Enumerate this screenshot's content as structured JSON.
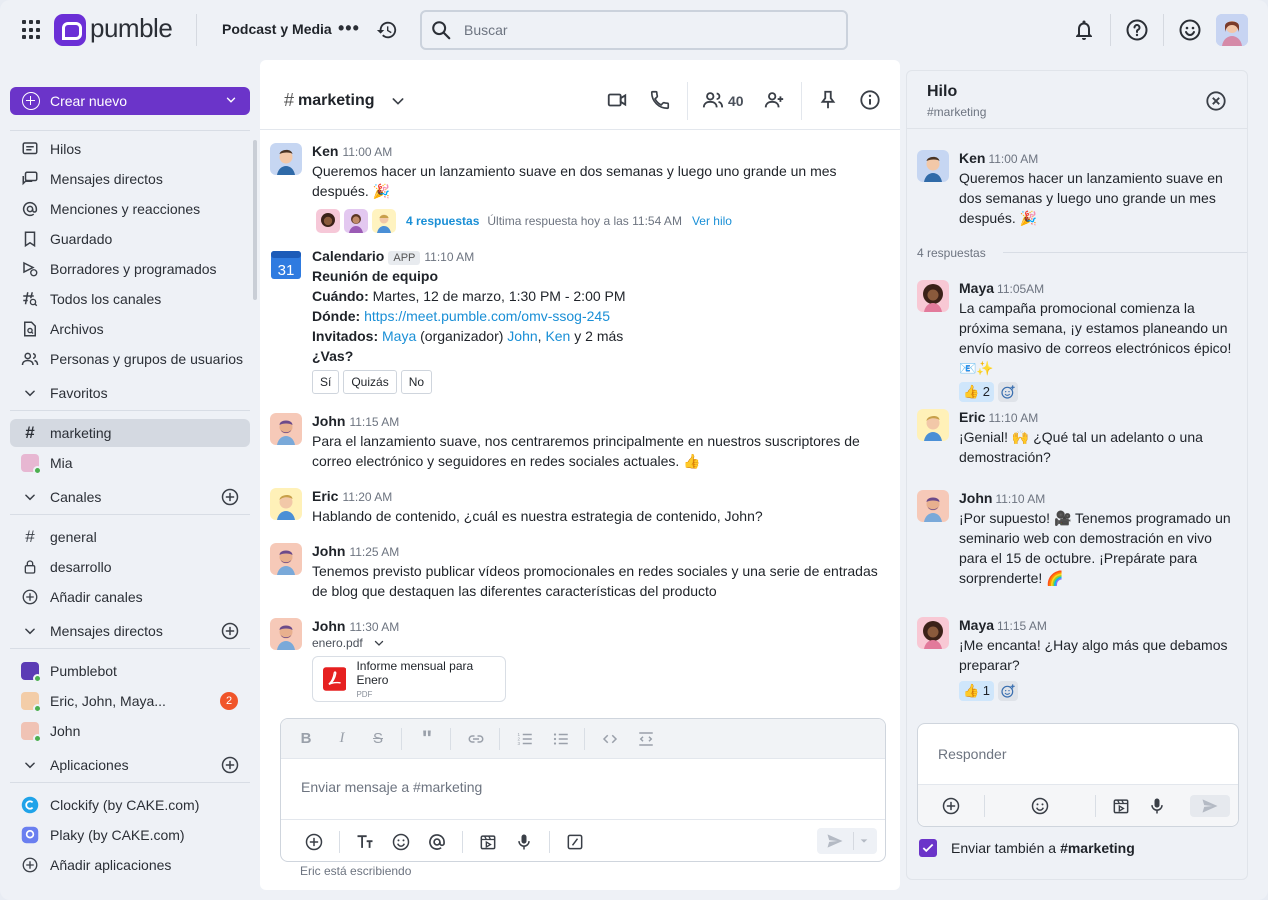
{
  "topbar": {
    "logo_text": "pumble",
    "workspace": "Podcast y Media",
    "search_placeholder": "Buscar"
  },
  "sidebar": {
    "create_label": "Crear nuevo",
    "nav": [
      {
        "label": "Hilos",
        "icon": "threads-icon"
      },
      {
        "label": "Mensajes directos",
        "icon": "direct-messages-icon"
      },
      {
        "label": "Menciones y reacciones",
        "icon": "at-icon"
      },
      {
        "label": "Guardado",
        "icon": "bookmark-icon"
      },
      {
        "label": "Borradores y programados",
        "icon": "drafts-icon"
      },
      {
        "label": "Todos los canales",
        "icon": "channels-search-icon"
      },
      {
        "label": "Archivos",
        "icon": "files-icon"
      },
      {
        "label": "Personas y grupos de usuarios",
        "icon": "people-icon"
      }
    ],
    "favorites_label": "Favoritos",
    "favorites": [
      {
        "label": "marketing"
      },
      {
        "label": "Mia"
      }
    ],
    "channels_label": "Canales",
    "channels": [
      {
        "label": "general"
      },
      {
        "label": "desarrollo"
      },
      {
        "label": "Añadir canales"
      }
    ],
    "dms_label": "Mensajes directos",
    "dms": [
      {
        "label": "Pumblebot"
      },
      {
        "label": "Eric, John, Maya...",
        "badge": "2"
      },
      {
        "label": "John"
      }
    ],
    "apps_label": "Aplicaciones",
    "apps": [
      {
        "label": "Clockify (by CAKE.com)"
      },
      {
        "label": "Plaky (by CAKE.com)"
      },
      {
        "label": "Añadir aplicaciones"
      }
    ]
  },
  "channel": {
    "name": "marketing",
    "member_count": "40"
  },
  "messages": [
    {
      "author": "Ken",
      "time": "11:00 AM",
      "text": "Queremos hacer un lanzamiento suave en dos semanas y luego uno grande un mes después. 🎉",
      "replies_label": "4 respuestas",
      "last_reply": "Última respuesta hoy a las 11:54 AM",
      "view_thread": "Ver hilo"
    },
    {
      "author": "Calendario",
      "tag": "APP",
      "time": "11:10 AM",
      "event_title": "Reunión de equipo",
      "when_label": "Cuándo:",
      "when_value": "Martes, 12 de marzo, 1:30 PM - 2:00 PM",
      "where_label": "Dónde:",
      "where_value": "https://meet.pumble.com/omv-ssog-245",
      "guests_label": "Invitados:",
      "guest_1": "Maya",
      "guest_1_note": "(organizador)",
      "guest_2": "John",
      "guest_3": "Ken",
      "guests_more": "y 2 más",
      "question": "¿Vas?",
      "rsvp": [
        "Sí",
        "Quizás",
        "No"
      ]
    },
    {
      "author": "John",
      "time": "11:15 AM",
      "text": "Para el lanzamiento suave, nos centraremos principalmente en nuestros suscriptores de correo electrónico y seguidores en redes sociales actuales. 👍"
    },
    {
      "author": "Eric",
      "time": "11:20 AM",
      "text": "Hablando de contenido, ¿cuál es nuestra estrategia de contenido, John?"
    },
    {
      "author": "John",
      "time": "11:25 AM",
      "text": "Tenemos previsto publicar vídeos promocionales en redes sociales y una serie de entradas de blog que destaquen las diferentes características del producto"
    },
    {
      "author": "John",
      "time": "11:30 AM",
      "file_name": "enero.pdf",
      "file_title": "Informe mensual para Enero",
      "file_type": "PDF"
    }
  ],
  "composer": {
    "placeholder": "Enviar mensaje a #marketing",
    "typing": "Eric está escribiendo"
  },
  "thread": {
    "title": "Hilo",
    "subtitle": "#marketing",
    "parent": {
      "author": "Ken",
      "time": "11:00 AM",
      "text": "Queremos hacer un lanzamiento suave en dos semanas y luego uno grande un mes después. 🎉"
    },
    "reply_count": "4 respuestas",
    "replies": [
      {
        "author": "Maya",
        "time": "11:05AM",
        "text": "La campaña promocional comienza la próxima semana, ¡y estamos planeando un envío masivo de correos electrónicos épico! 📧✨",
        "reaction": "👍 2"
      },
      {
        "author": "Eric",
        "time": "11:10 AM",
        "text": "¡Genial! 🙌 ¿Qué tal un adelanto o una demostración?"
      },
      {
        "author": "John",
        "time": "11:10 AM",
        "text": "¡Por supuesto! 🎥 Tenemos programado un seminario web con demostración en vivo para el 15 de octubre. ¡Prepárate para sorprenderte! 🌈"
      },
      {
        "author": "Maya",
        "time": "11:15 AM",
        "text": "¡Me encanta! ¿Hay algo más que debamos preparar?",
        "reaction": "👍 1"
      }
    ],
    "reply_placeholder": "Responder",
    "also_send_prefix": "Enviar también a",
    "also_send_channel": "#marketing"
  },
  "colors": {
    "brand": "#6b34c9",
    "link": "#1a8fd6",
    "badge": "#f0552a"
  }
}
